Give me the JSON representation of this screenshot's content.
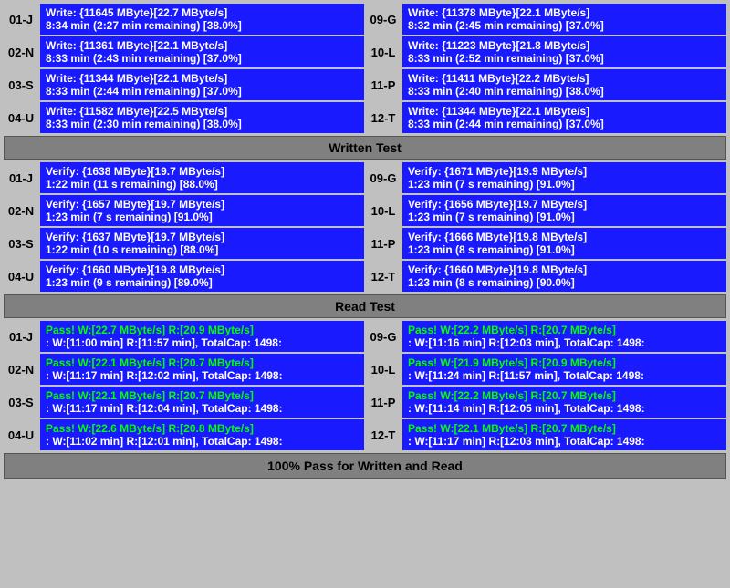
{
  "sections": {
    "write_test": {
      "label": "Written Test",
      "rows": [
        {
          "left": {
            "id": "01-J",
            "line1": "Write: {11645 MByte}[22.7 MByte/s]",
            "line2": "8:34 min (2:27 min remaining)  [38.0%]"
          },
          "right": {
            "id": "09-G",
            "line1": "Write: {11378 MByte}[22.1 MByte/s]",
            "line2": "8:32 min (2:45 min remaining)  [37.0%]"
          }
        },
        {
          "left": {
            "id": "02-N",
            "line1": "Write: {11361 MByte}[22.1 MByte/s]",
            "line2": "8:33 min (2:43 min remaining)  [37.0%]"
          },
          "right": {
            "id": "10-L",
            "line1": "Write: {11223 MByte}[21.8 MByte/s]",
            "line2": "8:33 min (2:52 min remaining)  [37.0%]"
          }
        },
        {
          "left": {
            "id": "03-S",
            "line1": "Write: {11344 MByte}[22.1 MByte/s]",
            "line2": "8:33 min (2:44 min remaining)  [37.0%]"
          },
          "right": {
            "id": "11-P",
            "line1": "Write: {11411 MByte}[22.2 MByte/s]",
            "line2": "8:33 min (2:40 min remaining)  [38.0%]"
          }
        },
        {
          "left": {
            "id": "04-U",
            "line1": "Write: {11582 MByte}[22.5 MByte/s]",
            "line2": "8:33 min (2:30 min remaining)  [38.0%]"
          },
          "right": {
            "id": "12-T",
            "line1": "Write: {11344 MByte}[22.1 MByte/s]",
            "line2": "8:33 min (2:44 min remaining)  [37.0%]"
          }
        }
      ]
    },
    "verify_test": {
      "label": "Written Test",
      "rows": [
        {
          "left": {
            "id": "01-J",
            "line1": "Verify: {1638 MByte}[19.7 MByte/s]",
            "line2": "1:22 min (11 s remaining)  [88.0%]"
          },
          "right": {
            "id": "09-G",
            "line1": "Verify: {1671 MByte}[19.9 MByte/s]",
            "line2": "1:23 min (7 s remaining)  [91.0%]"
          }
        },
        {
          "left": {
            "id": "02-N",
            "line1": "Verify: {1657 MByte}[19.7 MByte/s]",
            "line2": "1:23 min (7 s remaining)  [91.0%]"
          },
          "right": {
            "id": "10-L",
            "line1": "Verify: {1656 MByte}[19.7 MByte/s]",
            "line2": "1:23 min (7 s remaining)  [91.0%]"
          }
        },
        {
          "left": {
            "id": "03-S",
            "line1": "Verify: {1637 MByte}[19.7 MByte/s]",
            "line2": "1:22 min (10 s remaining)  [88.0%]"
          },
          "right": {
            "id": "11-P",
            "line1": "Verify: {1666 MByte}[19.8 MByte/s]",
            "line2": "1:23 min (8 s remaining)  [91.0%]"
          }
        },
        {
          "left": {
            "id": "04-U",
            "line1": "Verify: {1660 MByte}[19.8 MByte/s]",
            "line2": "1:23 min (9 s remaining)  [89.0%]"
          },
          "right": {
            "id": "12-T",
            "line1": "Verify: {1660 MByte}[19.8 MByte/s]",
            "line2": "1:23 min (8 s remaining)  [90.0%]"
          }
        }
      ]
    },
    "read_test": {
      "label": "Read Test",
      "rows": [
        {
          "left": {
            "id": "01-J",
            "line1": "Pass! W:[22.7 MByte/s] R:[20.9 MByte/s]",
            "line2": ": W:[11:00 min] R:[11:57 min], TotalCap: 1498:"
          },
          "right": {
            "id": "09-G",
            "line1": "Pass! W:[22.2 MByte/s] R:[20.7 MByte/s]",
            "line2": ": W:[11:16 min] R:[12:03 min], TotalCap: 1498:"
          }
        },
        {
          "left": {
            "id": "02-N",
            "line1": "Pass! W:[22.1 MByte/s] R:[20.7 MByte/s]",
            "line2": ": W:[11:17 min] R:[12:02 min], TotalCap: 1498:"
          },
          "right": {
            "id": "10-L",
            "line1": "Pass! W:[21.9 MByte/s] R:[20.9 MByte/s]",
            "line2": ": W:[11:24 min] R:[11:57 min], TotalCap: 1498:"
          }
        },
        {
          "left": {
            "id": "03-S",
            "line1": "Pass! W:[22.1 MByte/s] R:[20.7 MByte/s]",
            "line2": ": W:[11:17 min] R:[12:04 min], TotalCap: 1498:"
          },
          "right": {
            "id": "11-P",
            "line1": "Pass! W:[22.2 MByte/s] R:[20.7 MByte/s]",
            "line2": ": W:[11:14 min] R:[12:05 min], TotalCap: 1498:"
          }
        },
        {
          "left": {
            "id": "04-U",
            "line1": "Pass! W:[22.6 MByte/s] R:[20.8 MByte/s]",
            "line2": ": W:[11:02 min] R:[12:01 min], TotalCap: 1498:"
          },
          "right": {
            "id": "12-T",
            "line1": "Pass! W:[22.1 MByte/s] R:[20.7 MByte/s]",
            "line2": ": W:[11:17 min] R:[12:03 min], TotalCap: 1498:"
          }
        }
      ]
    }
  },
  "footer": {
    "label": "100% Pass for Written and Read"
  },
  "headers": {
    "written_test": "Written Test",
    "read_test": "Read Test"
  }
}
